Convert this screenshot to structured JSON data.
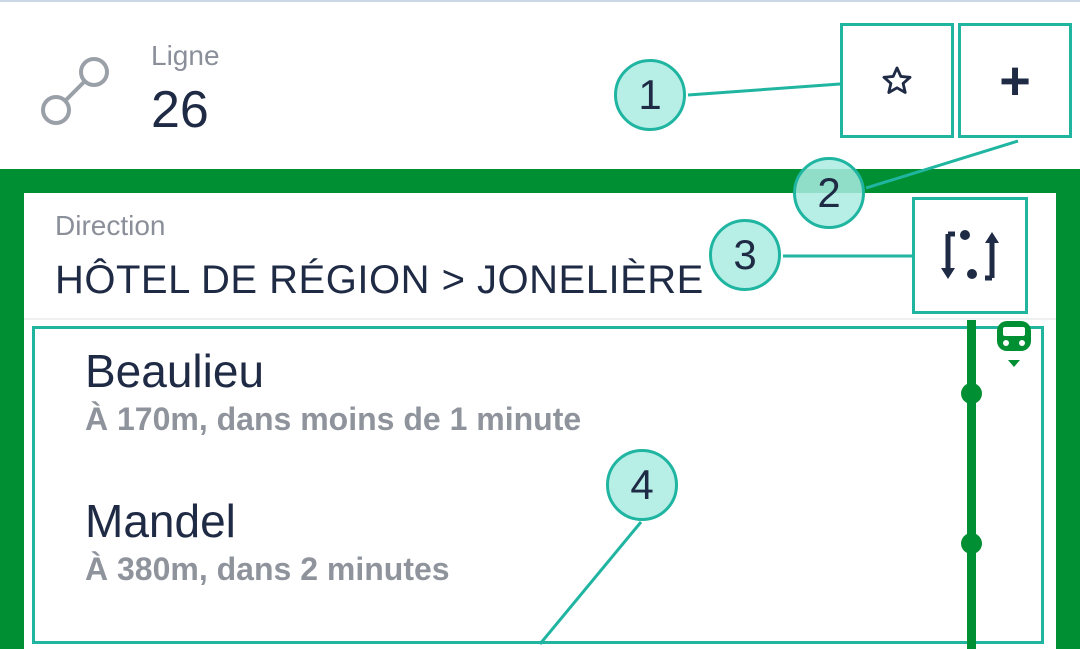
{
  "header": {
    "line_label": "Ligne",
    "line_number": "26",
    "favorite_icon": "star-outline-icon",
    "add_label": "+"
  },
  "direction": {
    "label": "Direction",
    "value": "HÔTEL DE RÉGION > JONELIÈRE",
    "swap_icon": "swap-direction-icon"
  },
  "stops": [
    {
      "name": "Beaulieu",
      "info": "À 170m, dans moins de 1 minute"
    },
    {
      "name": "Mandel",
      "info": "À 380m, dans 2 minutes"
    }
  ],
  "callouts": [
    "1",
    "2",
    "3",
    "4"
  ],
  "colors": {
    "line_green": "#008f32",
    "annotation_teal": "#1fb5a1",
    "text_dark": "#1f2a44",
    "text_gray": "#8f949c"
  }
}
